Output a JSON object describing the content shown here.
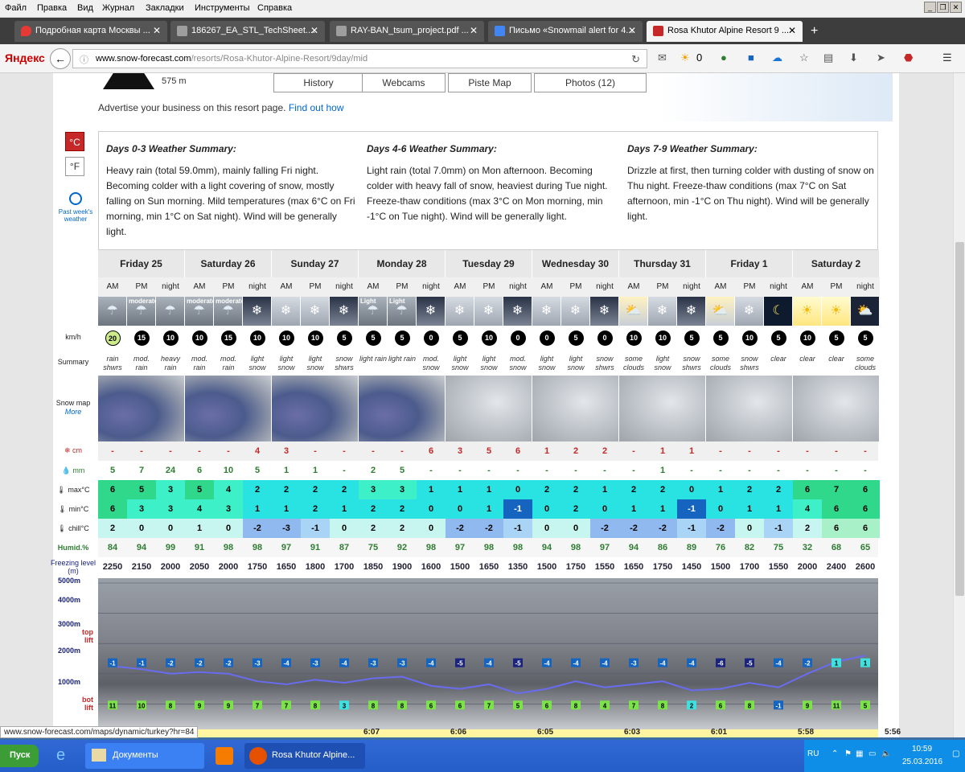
{
  "menu": [
    "Файл",
    "Правка",
    "Вид",
    "Журнал",
    "Закладки",
    "Инструменты",
    "Справка"
  ],
  "tabs": [
    {
      "label": "Подробная карта Москвы ...",
      "icon": "map-pin-icon",
      "color": "#e53935"
    },
    {
      "label": "186267_EA_STL_TechSheet....",
      "icon": "document-icon",
      "color": "#8e8e8e"
    },
    {
      "label": "RAY-BAN_tsum_project.pdf ...",
      "icon": "document-icon",
      "color": "#8e8e8e"
    },
    {
      "label": "Письмо «Snowmail alert for 4...",
      "icon": "mail-icon",
      "color": "#4285f4"
    },
    {
      "label": "Rosa Khutor Alpine Resort 9 ...",
      "icon": "snowflake-icon",
      "color": "#c62828",
      "active": true
    }
  ],
  "browser": {
    "brand": "Яндекс",
    "url_host": "www.snow-forecast.com",
    "url_path": "/resorts/Rosa-Khutor-Alpine-Resort/9day/mid",
    "weather_temp": "0"
  },
  "resort_header": {
    "elevation": "575 m",
    "buttons": [
      "History",
      "Webcams",
      "Piste Map",
      "Photos (12)"
    ],
    "advert_text": "Advertise your business on this resort page.",
    "advert_link": "Find out how"
  },
  "units": {
    "celsius": "°C",
    "fahrenheit": "°F",
    "past_week": "Past week's weather"
  },
  "summaries": [
    {
      "title": "Days 0-3 Weather Summary:",
      "text": "Heavy rain (total 59.0mm), mainly falling Fri night. Becoming colder with a light covering of snow, mostly falling on Sun morning. Mild temperatures (max 6°C on Fri morning, min 1°C on Sat night). Wind will be generally light."
    },
    {
      "title": "Days 4-6 Weather Summary:",
      "text": "Light rain (total 7.0mm) on Mon afternoon. Becoming colder with heavy fall of snow, heaviest during Tue night. Freeze-thaw conditions (max 3°C on Mon morning, min -1°C on Tue night). Wind will be generally light."
    },
    {
      "title": "Days 7-9 Weather Summary:",
      "text": "Drizzle at first, then turning colder with dusting of snow on Thu night. Freeze-thaw conditions (max 7°C on Sat afternoon, min -1°C on Thu night). Wind will be generally light."
    }
  ],
  "row_labels": {
    "wind": "km/h",
    "summary": "Summary",
    "snowmap": "Snow map",
    "snowmap_more": "More",
    "snow": "cm",
    "rain": "mm",
    "max": "max°C",
    "min": "min°C",
    "chill": "chill°C",
    "humid": "Humid.%",
    "freezing": "Freezing level (m)"
  },
  "days": [
    "Friday 25",
    "Saturday 26",
    "Sunday 27",
    "Monday 28",
    "Tuesday 29",
    "Wednesday 30",
    "Thursday 31",
    "Friday 1",
    "Saturday 2"
  ],
  "times": [
    "AM",
    "PM",
    "night"
  ],
  "weather_icon_labels": [
    "",
    "moderate",
    "",
    "moderate",
    "moderate",
    "",
    "",
    "",
    "",
    "Light",
    "Light",
    "",
    "",
    "",
    "",
    "",
    "",
    "",
    "",
    "",
    "",
    "",
    "",
    "",
    "",
    "",
    ""
  ],
  "wind": [
    20,
    15,
    10,
    10,
    15,
    10,
    10,
    10,
    5,
    5,
    5,
    0,
    5,
    10,
    0,
    0,
    5,
    0,
    10,
    10,
    5,
    5,
    10,
    5,
    10,
    5,
    5
  ],
  "summary": [
    "rain shwrs",
    "mod. rain",
    "heavy rain",
    "mod. rain",
    "mod. rain",
    "light snow",
    "light snow",
    "light snow",
    "snow shwrs",
    "light rain",
    "light rain",
    "mod. snow",
    "light snow",
    "light snow",
    "mod. snow",
    "light snow",
    "light snow",
    "snow shwrs",
    "some clouds",
    "light snow",
    "snow shwrs",
    "some clouds",
    "snow shwrs",
    "clear",
    "clear",
    "clear",
    "some clouds"
  ],
  "snow_cm": [
    "-",
    "-",
    "-",
    "-",
    "-",
    "4",
    "3",
    "-",
    "-",
    "-",
    "-",
    "6",
    "3",
    "5",
    "6",
    "1",
    "2",
    "2",
    "-",
    "1",
    "1",
    "-",
    "-",
    "-",
    "-",
    "-",
    "-"
  ],
  "rain_mm": [
    "5",
    "7",
    "24",
    "6",
    "10",
    "5",
    "1",
    "1",
    "-",
    "2",
    "5",
    "-",
    "-",
    "-",
    "-",
    "-",
    "-",
    "-",
    "-",
    "1",
    "-",
    "-",
    "-",
    "-",
    "-",
    "-",
    "-"
  ],
  "max_c": [
    6,
    5,
    3,
    5,
    4,
    2,
    2,
    2,
    2,
    3,
    3,
    1,
    1,
    1,
    0,
    2,
    2,
    1,
    2,
    2,
    0,
    1,
    2,
    2,
    6,
    7,
    6
  ],
  "min_c": [
    6,
    3,
    3,
    4,
    3,
    1,
    1,
    2,
    1,
    2,
    2,
    0,
    0,
    1,
    -1,
    0,
    2,
    0,
    1,
    1,
    -1,
    0,
    1,
    1,
    4,
    6,
    6
  ],
  "chill_c": [
    2,
    0,
    0,
    1,
    0,
    -2,
    -3,
    -1,
    0,
    2,
    2,
    0,
    -2,
    -2,
    -1,
    0,
    0,
    -2,
    -2,
    -2,
    -1,
    -2,
    0,
    -1,
    2,
    6,
    6
  ],
  "humidity": [
    84,
    94,
    99,
    91,
    98,
    98,
    97,
    91,
    87,
    75,
    92,
    98,
    97,
    98,
    98,
    94,
    98,
    97,
    94,
    86,
    89,
    76,
    82,
    75,
    32,
    68,
    65
  ],
  "freezing": [
    2250,
    2150,
    2000,
    2050,
    2000,
    1750,
    1650,
    1800,
    1700,
    1850,
    1900,
    1600,
    1500,
    1650,
    1350,
    1500,
    1750,
    1550,
    1650,
    1750,
    1450,
    1500,
    1700,
    1550,
    2000,
    2400,
    2600
  ],
  "chart": {
    "levels": [
      "5000m",
      "4000m",
      "3000m",
      "2000m",
      "1000m"
    ],
    "top_lift_label": "top lift",
    "bot_lift_label": "bot lift",
    "top_lift_temps": [
      -1,
      -1,
      -2,
      -2,
      -2,
      -3,
      -4,
      -3,
      -4,
      -3,
      -3,
      -4,
      -5,
      -4,
      -5,
      -4,
      -4,
      -4,
      -3,
      -4,
      -4,
      -6,
      -5,
      -4,
      -2,
      1,
      1
    ],
    "bot_lift_temps": [
      11,
      10,
      8,
      9,
      9,
      7,
      7,
      8,
      3,
      8,
      8,
      6,
      6,
      7,
      5,
      6,
      8,
      4,
      7,
      8,
      2,
      6,
      8,
      -1,
      9,
      11,
      5
    ]
  },
  "sunrise": [
    "",
    "6:07",
    "6:06",
    "6:05",
    "6:03",
    "6:01",
    "5:58",
    "5:56"
  ],
  "status_url": "www.snow-forecast.com/maps/dynamic/turkey?hr=84",
  "taskbar": {
    "start": "Пуск",
    "items": [
      "Документы",
      "Rosa Khutor Alpine..."
    ],
    "lang": "RU",
    "time": "10:59",
    "date": "25.03.2016"
  }
}
